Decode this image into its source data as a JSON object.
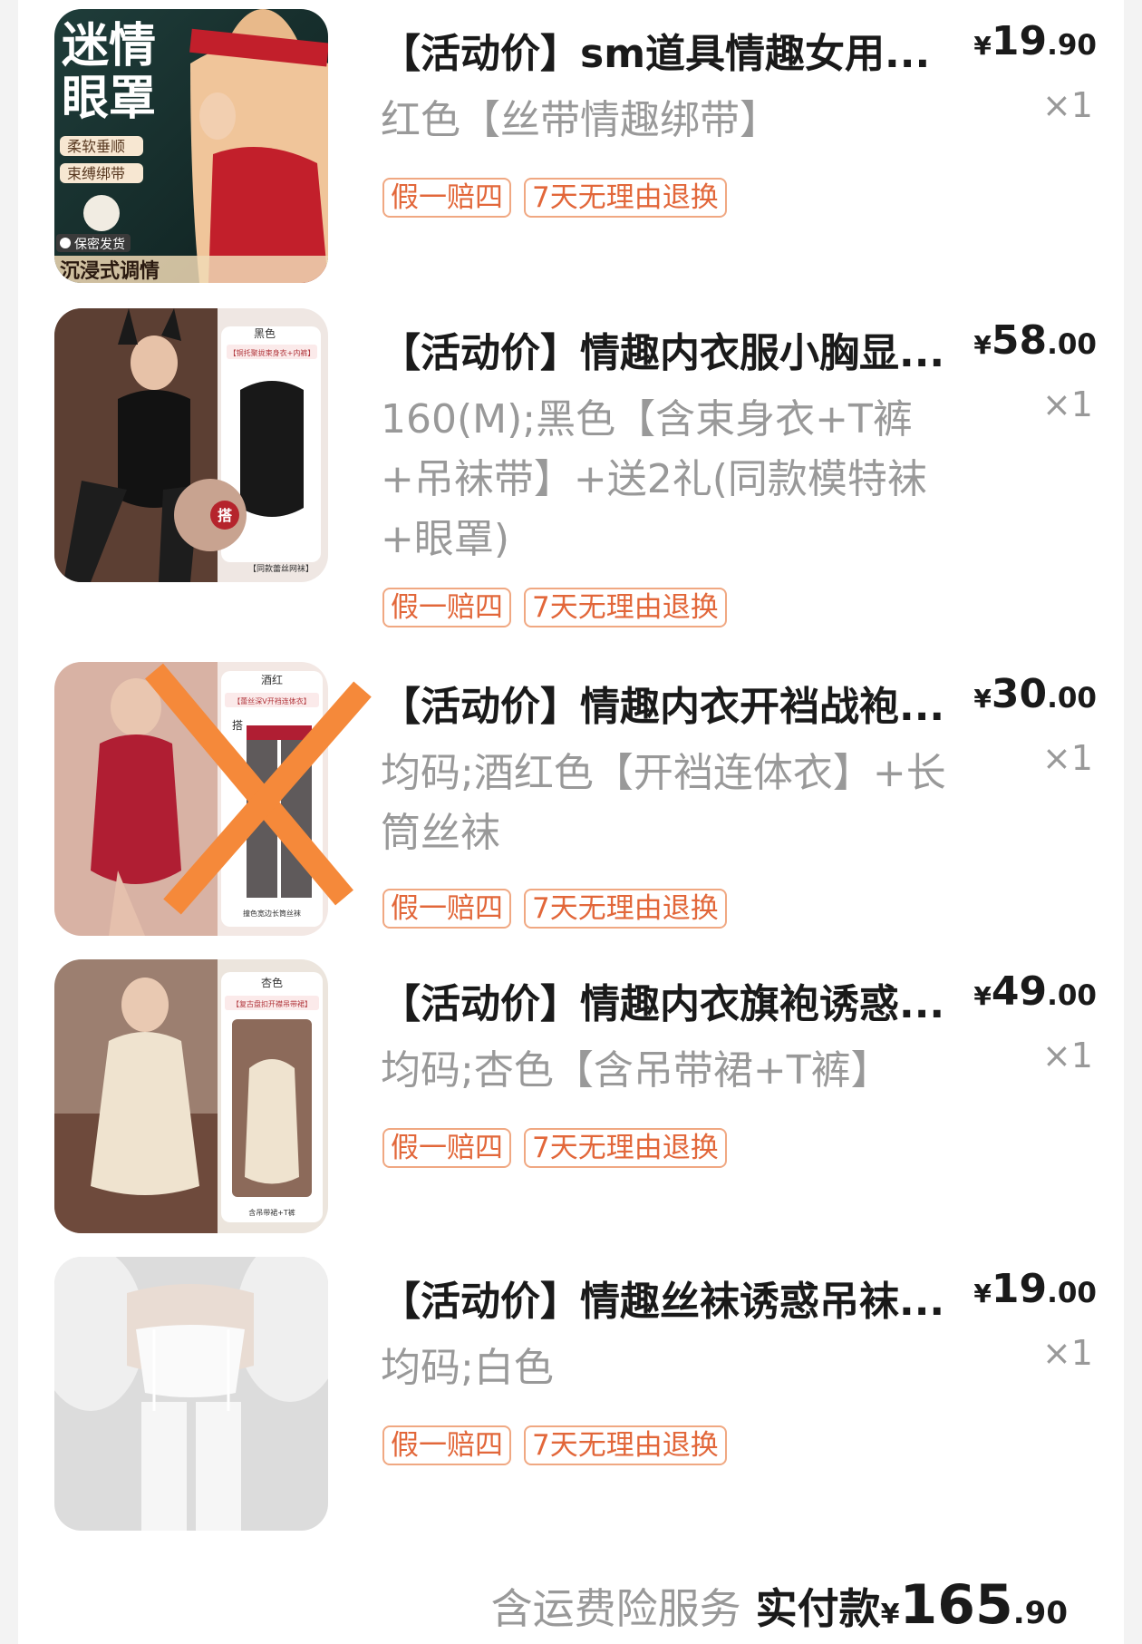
{
  "items": [
    {
      "title": "【活动价】sm道具情趣女用...",
      "spec": "红色【丝带情趣绑带】",
      "tags": [
        "假一赔四",
        "7天无理由退换"
      ],
      "price": {
        "currency": "¥",
        "int": "19",
        "dec": ".90"
      },
      "qty": "×1",
      "thumb_text": {
        "headline_1": "迷情",
        "headline_2": "眼罩",
        "badge_1": "柔软垂顺",
        "badge_2": "束缚绑带",
        "secure": "保密发货",
        "footer": "沉浸式调情"
      }
    },
    {
      "title": "【活动价】情趣内衣服小胸显...",
      "spec": "160(M);黑色【含束身衣+T裤+吊袜带】+送2礼(同款模特袜+眼罩)",
      "tags": [
        "假一赔四",
        "7天无理由退换"
      ],
      "price": {
        "currency": "¥",
        "int": "58",
        "dec": ".00"
      },
      "qty": "×1",
      "thumb_text": {
        "color": "黑色",
        "caption": "【铜托聚拢束身衣+内裤】",
        "pair": "搭",
        "bottom": "【同款蕾丝网袜】"
      }
    },
    {
      "title": "【活动价】情趣内衣开裆战袍...",
      "spec": "均码;酒红色【开裆连体衣】+长筒丝袜",
      "tags": [
        "假一赔四",
        "7天无理由退换"
      ],
      "price": {
        "currency": "¥",
        "int": "30",
        "dec": ".00"
      },
      "qty": "×1",
      "thumb_text": {
        "color": "酒红",
        "caption": "【蕾丝深V开裆连体衣】",
        "pair": "搭",
        "bottom": "撞色宽边长筒丝袜"
      }
    },
    {
      "title": "【活动价】情趣内衣旗袍诱惑...",
      "spec": "均码;杏色【含吊带裙+T裤】",
      "tags": [
        "假一赔四",
        "7天无理由退换"
      ],
      "price": {
        "currency": "¥",
        "int": "49",
        "dec": ".00"
      },
      "qty": "×1",
      "thumb_text": {
        "color": "杏色",
        "caption": "【复古盘扣开襟吊带裙】",
        "bottom": "含吊带裙+T裤"
      }
    },
    {
      "title": "【活动价】情趣丝袜诱惑吊袜...",
      "spec": "均码;白色",
      "tags": [
        "假一赔四",
        "7天无理由退换"
      ],
      "price": {
        "currency": "¥",
        "int": "19",
        "dec": ".00"
      },
      "qty": "×1",
      "thumb_text": {}
    }
  ],
  "summary": {
    "insurance": "含运费险服务",
    "paid_label": "实付款",
    "currency": "¥",
    "int": "165",
    "dec": ".90"
  },
  "colors": {
    "tag_border": "#f0a882",
    "tag_text": "#e2673a",
    "spec_text": "#999999",
    "title_text": "#1a1a1a",
    "cross_mark": "#f5893a"
  }
}
